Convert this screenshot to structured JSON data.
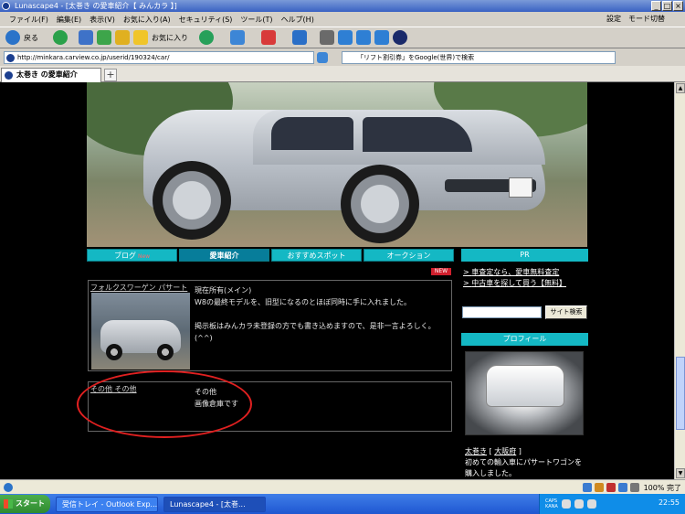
{
  "window": {
    "title": "Lunascape4 - [太巻き の愛車紹介【 みんカラ 】]",
    "minimize": "_",
    "restore": "□",
    "close": "×"
  },
  "menu": {
    "items": [
      "ファイル(F)",
      "編集(E)",
      "表示(V)",
      "お気に入り(A)",
      "セキュリティ(S)",
      "ツール(T)",
      "ヘルプ(H)"
    ],
    "settings": "設定",
    "mode": "モード切替"
  },
  "toolbar": {
    "back": "戻る",
    "favorites": "お気に入り"
  },
  "address": {
    "url": "http://minkara.carview.co.jp/userid/190324/car/",
    "search_placeholder": "「リフト割引券」をGoogle(世界)で検索"
  },
  "tab": {
    "title": "太巻き の愛車紹介"
  },
  "page": {
    "nav": [
      {
        "label": "ブログ",
        "badge": "New"
      },
      {
        "label": "愛車紹介"
      },
      {
        "label": "おすすめスポット"
      },
      {
        "label": "オークション"
      }
    ],
    "pr_title": "PR",
    "new_tag": "NEW",
    "cars": [
      {
        "name": "フォルクスワーゲン パサート",
        "status": "現在所有(メイン)",
        "desc1": "W8の最終モデルを、旧型になるのとほぼ同時に手に入れました。",
        "desc2": "掲示板はみんカラ未登録の方でも書き込めますので、是非一言よろしく。(^^)"
      },
      {
        "name": "その他 その他",
        "status": "その他",
        "desc1": "画像倉庫です"
      }
    ],
    "pr_links": [
      "車査定なら、愛車無料査定",
      "中古車を探して買う【無料】"
    ],
    "search_button": "サイト検索",
    "profile_title": "プロフィール",
    "profile_name": "太巻き",
    "profile_location": "大阪府",
    "profile_text": "初めての輸入車にパサートワゴンを購入しました。"
  },
  "status": {
    "zoom": "100%",
    "done": "完了"
  },
  "taskbar": {
    "start": "スタート",
    "tasks": [
      "受信トレイ - Outlook Exp...",
      "Lunascape4 - [太巻..."
    ],
    "clock": "22:55",
    "caps": "CAPS",
    "kana": "KANA"
  }
}
